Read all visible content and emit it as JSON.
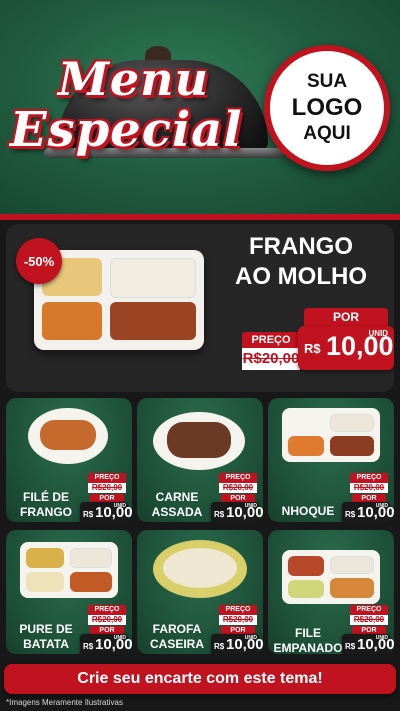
{
  "header": {
    "title_line1": "Menu",
    "title_line2": "Especial",
    "logo": {
      "line1": "SUA",
      "line2": "LOGO",
      "line3": "AQUI"
    }
  },
  "featured": {
    "discount_badge": "-50%",
    "name": "FRANGO\nAO MOLHO",
    "preco_label": "PREÇO",
    "old_price": "R$20,00",
    "por_label": "POR",
    "currency": "R$",
    "price": "10,00",
    "unit": "UNID"
  },
  "items": [
    {
      "name": "FILÉ DE\nFRANGO",
      "preco_label": "PREÇO",
      "old_price": "R$20,00",
      "por_label": "POR",
      "currency": "R$",
      "price": "10,00",
      "unit": "UNID"
    },
    {
      "name": "CARNE\nASSADA",
      "preco_label": "PREÇO",
      "old_price": "R$20,00",
      "por_label": "POR",
      "currency": "R$",
      "price": "10,00",
      "unit": "UNID"
    },
    {
      "name": "NHOQUE",
      "preco_label": "PREÇO",
      "old_price": "R$20,00",
      "por_label": "POR",
      "currency": "R$",
      "price": "10,00",
      "unit": "UNID"
    },
    {
      "name": "PURE DE\nBATATA",
      "preco_label": "PREÇO",
      "old_price": "R$20,00",
      "por_label": "POR",
      "currency": "R$",
      "price": "10,00",
      "unit": "UNID"
    },
    {
      "name": "FAROFA\nCASEIRA",
      "preco_label": "PREÇO",
      "old_price": "R$20,00",
      "por_label": "POR",
      "currency": "R$",
      "price": "10,00",
      "unit": "UNID"
    },
    {
      "name": "FILE\nEMPANADO",
      "preco_label": "PREÇO",
      "old_price": "R$20,00",
      "por_label": "POR",
      "currency": "R$",
      "price": "10,00",
      "unit": "UNID"
    }
  ],
  "cta": "Crie seu encarte com este tema!",
  "disclaimer": "*Imagens Meramente Ilustrativas",
  "colors": {
    "brand_red": "#c1121f",
    "green": "#1f5a3e",
    "dark": "#262626"
  }
}
